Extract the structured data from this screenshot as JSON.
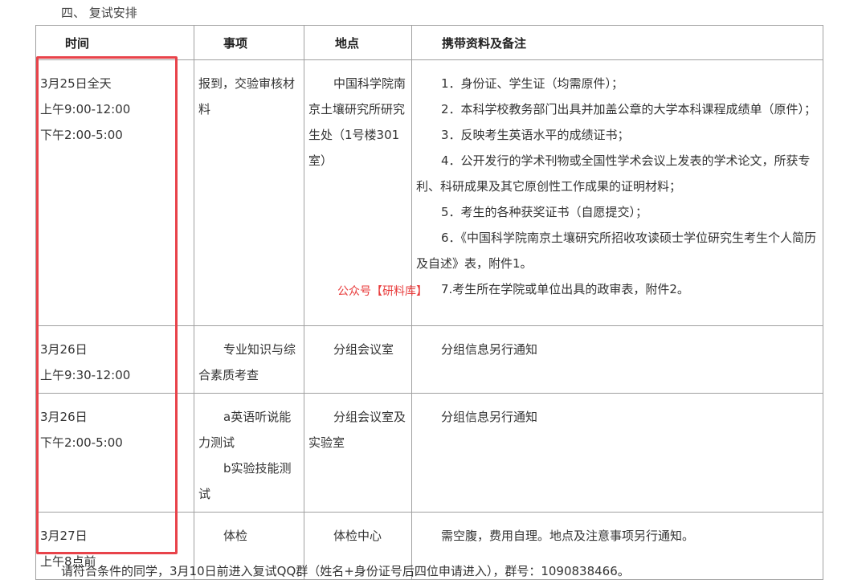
{
  "section_heading": "四、 复试安排",
  "table": {
    "headers": {
      "time": "时间",
      "item": "事项",
      "place": "地点",
      "notes": "携带资料及备注"
    },
    "rows": [
      {
        "time": [
          "3月25日全天",
          "上午9:00-12:00",
          "下午2:00-5:00"
        ],
        "item": [
          "报到，交验审核材料"
        ],
        "place": [
          "中国科学院南京土壤研究所研究生处（1号楼301室）"
        ],
        "notes": [
          "1．身份证、学生证（均需原件）；",
          "2．本科学校教务部门出具并加盖公章的大学本科课程成绩单（原件）；",
          "3．反映考生英语水平的成绩证书；",
          "4．公开发行的学术刊物或全国性学术会议上发表的学术论文，所获专利、科研成果及其它原创性工作成果的证明材料；",
          "5．考生的各种获奖证书（自愿提交）；",
          "6．《中国科学院南京土壤研究所招收攻读硕士学位研究生考生个人简历及自述》表，附件1。",
          "7.考生所在学院或单位出具的政审表，附件2。"
        ]
      },
      {
        "time": [
          "3月26日",
          "上午9:30-12:00"
        ],
        "item": [
          "专业知识与综合素质考查"
        ],
        "place": [
          "分组会议室"
        ],
        "notes": [
          "分组信息另行通知"
        ]
      },
      {
        "time": [
          "3月26日",
          "下午2:00-5:00"
        ],
        "item": [
          "a英语听说能力测试",
          "b实验技能测试"
        ],
        "place": [
          "分组会议室及实验室"
        ],
        "notes": [
          "分组信息另行通知"
        ]
      },
      {
        "time": [
          "3月27日",
          "上午8点前"
        ],
        "item": [
          "体检"
        ],
        "place": [
          "体检中心"
        ],
        "notes": [
          "需空腹，费用自理。地点及注意事项另行通知。"
        ]
      }
    ]
  },
  "watermark": "公众号【研料库】",
  "footer_note": "请符合条件的同学，3月10日前进入复试QQ群（姓名+身份证号后四位申请进入），群号：1090838466。",
  "colors": {
    "highlight_border": "#e8434a",
    "watermark_text": "#e83a3a",
    "table_border": "#a0a0a0"
  }
}
